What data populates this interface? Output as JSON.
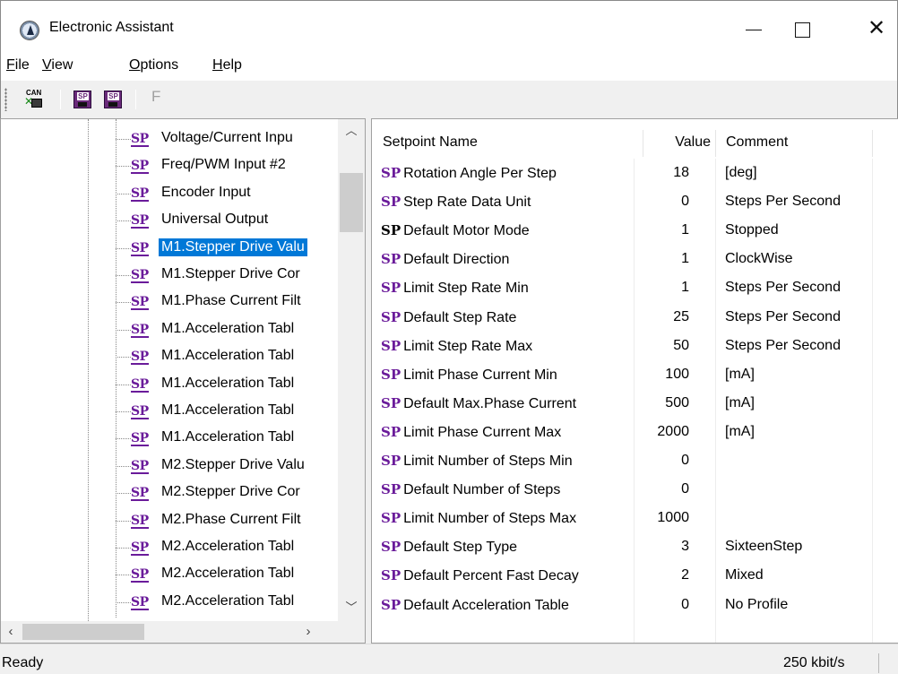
{
  "window": {
    "title": "Electronic Assistant",
    "minimize": "—",
    "maximize": "☐",
    "close": "✕"
  },
  "menu": [
    {
      "label": "File"
    },
    {
      "label": "View"
    },
    {
      "label": "Options"
    },
    {
      "label": "Help"
    }
  ],
  "toolbar": {
    "can_label": "CAN",
    "sp_label": "SP",
    "f_label": "F"
  },
  "tree": {
    "icon_label": "SP",
    "items": [
      {
        "label": "Voltage/Current Inpu"
      },
      {
        "label": "Freq/PWM Input #2"
      },
      {
        "label": "Encoder Input"
      },
      {
        "label": "Universal Output"
      },
      {
        "label": "M1.Stepper Drive Valu",
        "selected": true
      },
      {
        "label": "M1.Stepper Drive Cor"
      },
      {
        "label": "M1.Phase Current Filt"
      },
      {
        "label": "M1.Acceleration Tabl"
      },
      {
        "label": "M1.Acceleration Tabl"
      },
      {
        "label": "M1.Acceleration Tabl"
      },
      {
        "label": "M1.Acceleration Tabl"
      },
      {
        "label": "M1.Acceleration Tabl"
      },
      {
        "label": "M2.Stepper Drive Valu"
      },
      {
        "label": "M2.Stepper Drive Cor"
      },
      {
        "label": "M2.Phase Current Filt"
      },
      {
        "label": "M2.Acceleration Tabl"
      },
      {
        "label": "M2.Acceleration Tabl"
      },
      {
        "label": "M2.Acceleration Tabl"
      }
    ]
  },
  "grid": {
    "headers": {
      "name": "Setpoint Name",
      "value": "Value",
      "comment": "Comment"
    },
    "icon_label": "SP",
    "rows": [
      {
        "name": "Rotation Angle Per Step",
        "value": "18",
        "comment": "[deg]"
      },
      {
        "name": "Step Rate Data Unit",
        "value": "0",
        "comment": "Steps Per Second"
      },
      {
        "name": "Default Motor Mode",
        "value": "1",
        "comment": "Stopped",
        "black_icon": true
      },
      {
        "name": "Default Direction",
        "value": "1",
        "comment": "ClockWise"
      },
      {
        "name": "Limit Step Rate Min",
        "value": "1",
        "comment": "Steps Per Second"
      },
      {
        "name": "Default Step Rate",
        "value": "25",
        "comment": "Steps Per Second"
      },
      {
        "name": "Limit Step Rate Max",
        "value": "50",
        "comment": "Steps Per Second"
      },
      {
        "name": "Limit Phase Current Min",
        "value": "100",
        "comment": "[mA]"
      },
      {
        "name": "Default Max.Phase Current",
        "value": "500",
        "comment": "[mA]"
      },
      {
        "name": "Limit Phase Current Max",
        "value": "2000",
        "comment": "[mA]"
      },
      {
        "name": "Limit Number of Steps Min",
        "value": "0",
        "comment": ""
      },
      {
        "name": "Default Number of Steps",
        "value": "0",
        "comment": ""
      },
      {
        "name": "Limit Number of Steps Max",
        "value": "1000",
        "comment": ""
      },
      {
        "name": "Default Step Type",
        "value": "3",
        "comment": "SixteenStep"
      },
      {
        "name": "Default Percent Fast Decay",
        "value": "2",
        "comment": "Mixed"
      },
      {
        "name": "Default Acceleration Table",
        "value": "0",
        "comment": "No Profile"
      }
    ]
  },
  "status": {
    "text": "Ready",
    "rate": "250 kbit/s"
  },
  "colors": {
    "sp_icon": "#6a1b9a",
    "selection": "#0078d7"
  }
}
